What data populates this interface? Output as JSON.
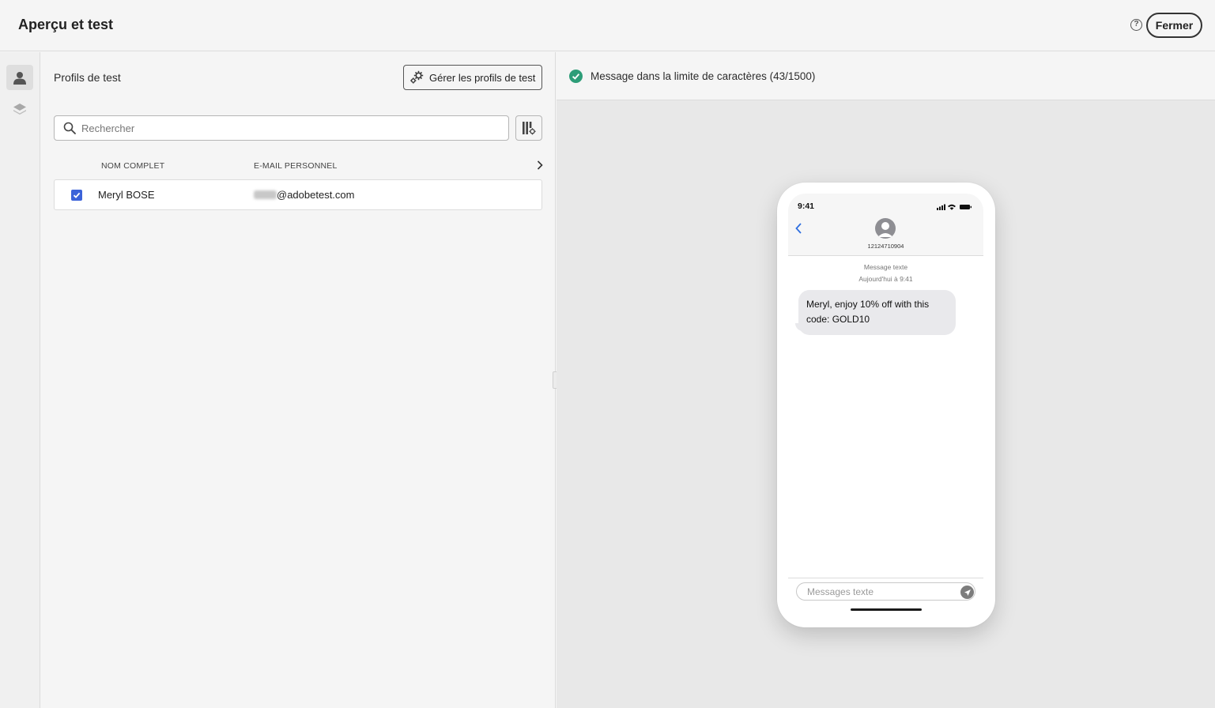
{
  "header": {
    "title": "Aperçu et test",
    "close_label": "Fermer",
    "help_glyph": "?"
  },
  "rail": {
    "items": [
      {
        "icon": "user-icon",
        "active": true
      },
      {
        "icon": "layers-icon",
        "active": false
      }
    ]
  },
  "profiles": {
    "title": "Profils de test",
    "manage_label": "Gérer les profils de test",
    "search_placeholder": "Rechercher",
    "columns": [
      "NOM COMPLET",
      "E-MAIL PERSONNEL"
    ],
    "rows": [
      {
        "checked": true,
        "name": "Meryl BOSE",
        "email_domain": "@adobetest.com"
      }
    ]
  },
  "preview": {
    "status_text": "Message dans la limite de caractères (43/1500)",
    "status_color": "#2d9d78",
    "phone": {
      "time": "9:41",
      "contact": "12124710904",
      "meta_label": "Message texte",
      "meta_time": "Aujourd'hui à  9:41",
      "message": "Meryl, enjoy 10% off with this code: GOLD10",
      "input_placeholder": "Messages texte"
    }
  }
}
